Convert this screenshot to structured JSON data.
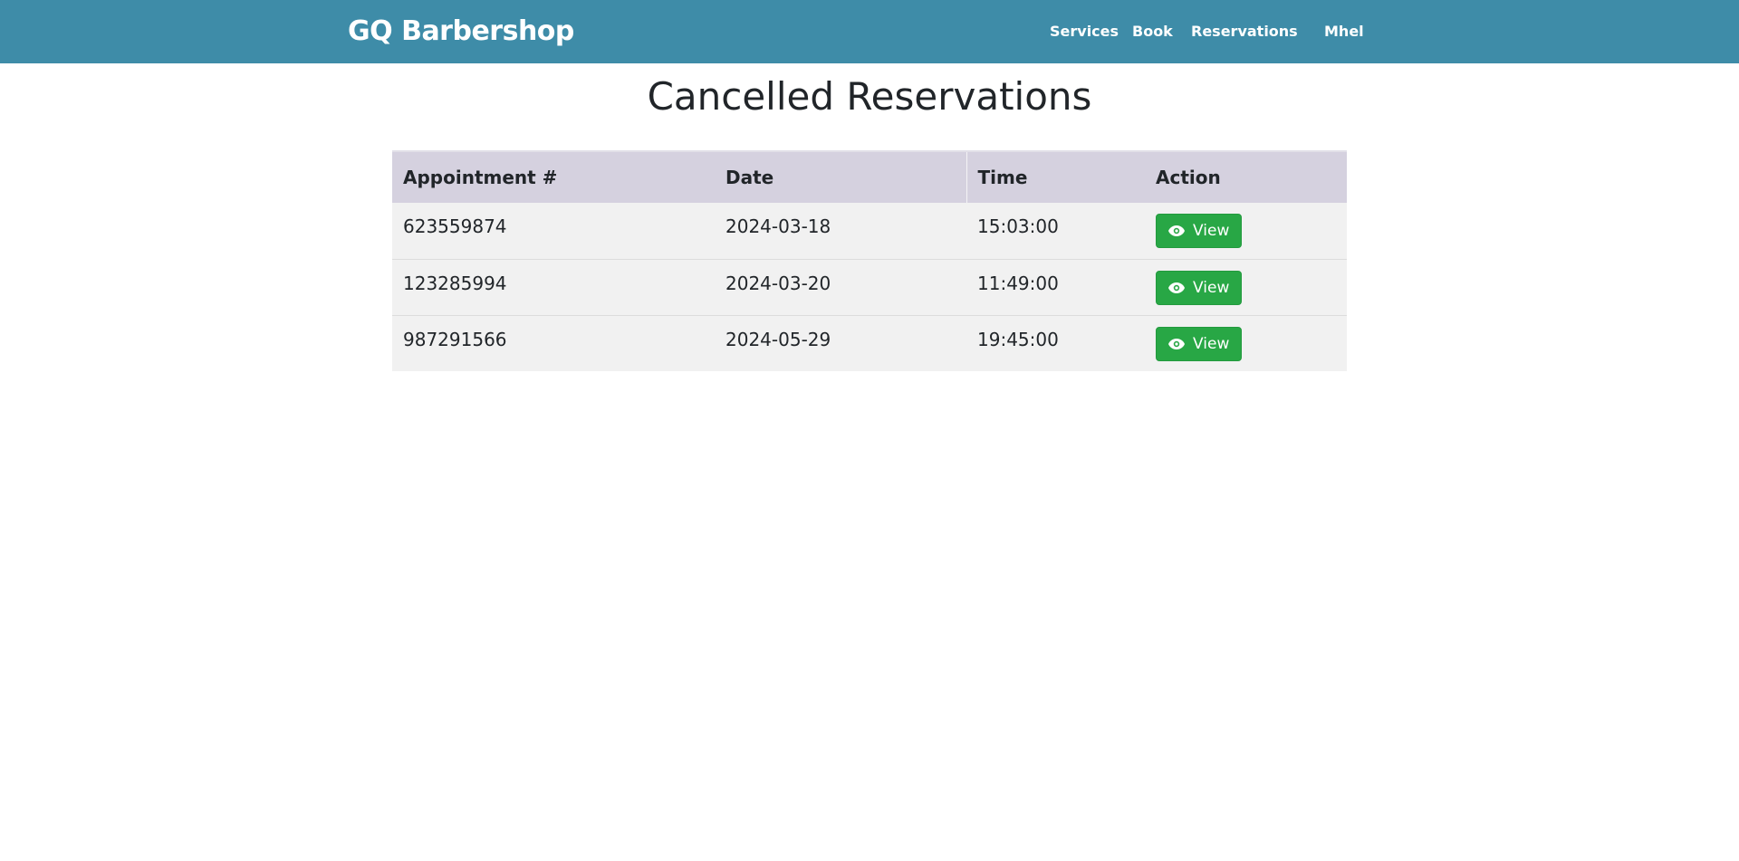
{
  "navbar": {
    "brand": "GQ Barbershop",
    "links": [
      {
        "label": "Services"
      },
      {
        "label": "Book"
      },
      {
        "label": "Reservations"
      },
      {
        "label": "Mhel"
      }
    ],
    "background_color": "#3e8ca8"
  },
  "main": {
    "title": "Cancelled Reservations",
    "table": {
      "columns": [
        "Appointment #",
        "Date",
        "Time",
        "Action"
      ],
      "rows": [
        {
          "appointment": "623559874",
          "date": "2024-03-18",
          "time": "15:03:00",
          "action_label": "View",
          "action_icon": "eye-icon"
        },
        {
          "appointment": "123285994",
          "date": "2024-03-20",
          "time": "11:49:00",
          "action_label": "View",
          "action_icon": "eye-icon"
        },
        {
          "appointment": "987291566",
          "date": "2024-05-29",
          "time": "19:45:00",
          "action_label": "View",
          "action_icon": "eye-icon"
        }
      ],
      "header_color": "#d5d1df",
      "row_color": "#f1f1f1",
      "button_color": "#28a745"
    }
  }
}
